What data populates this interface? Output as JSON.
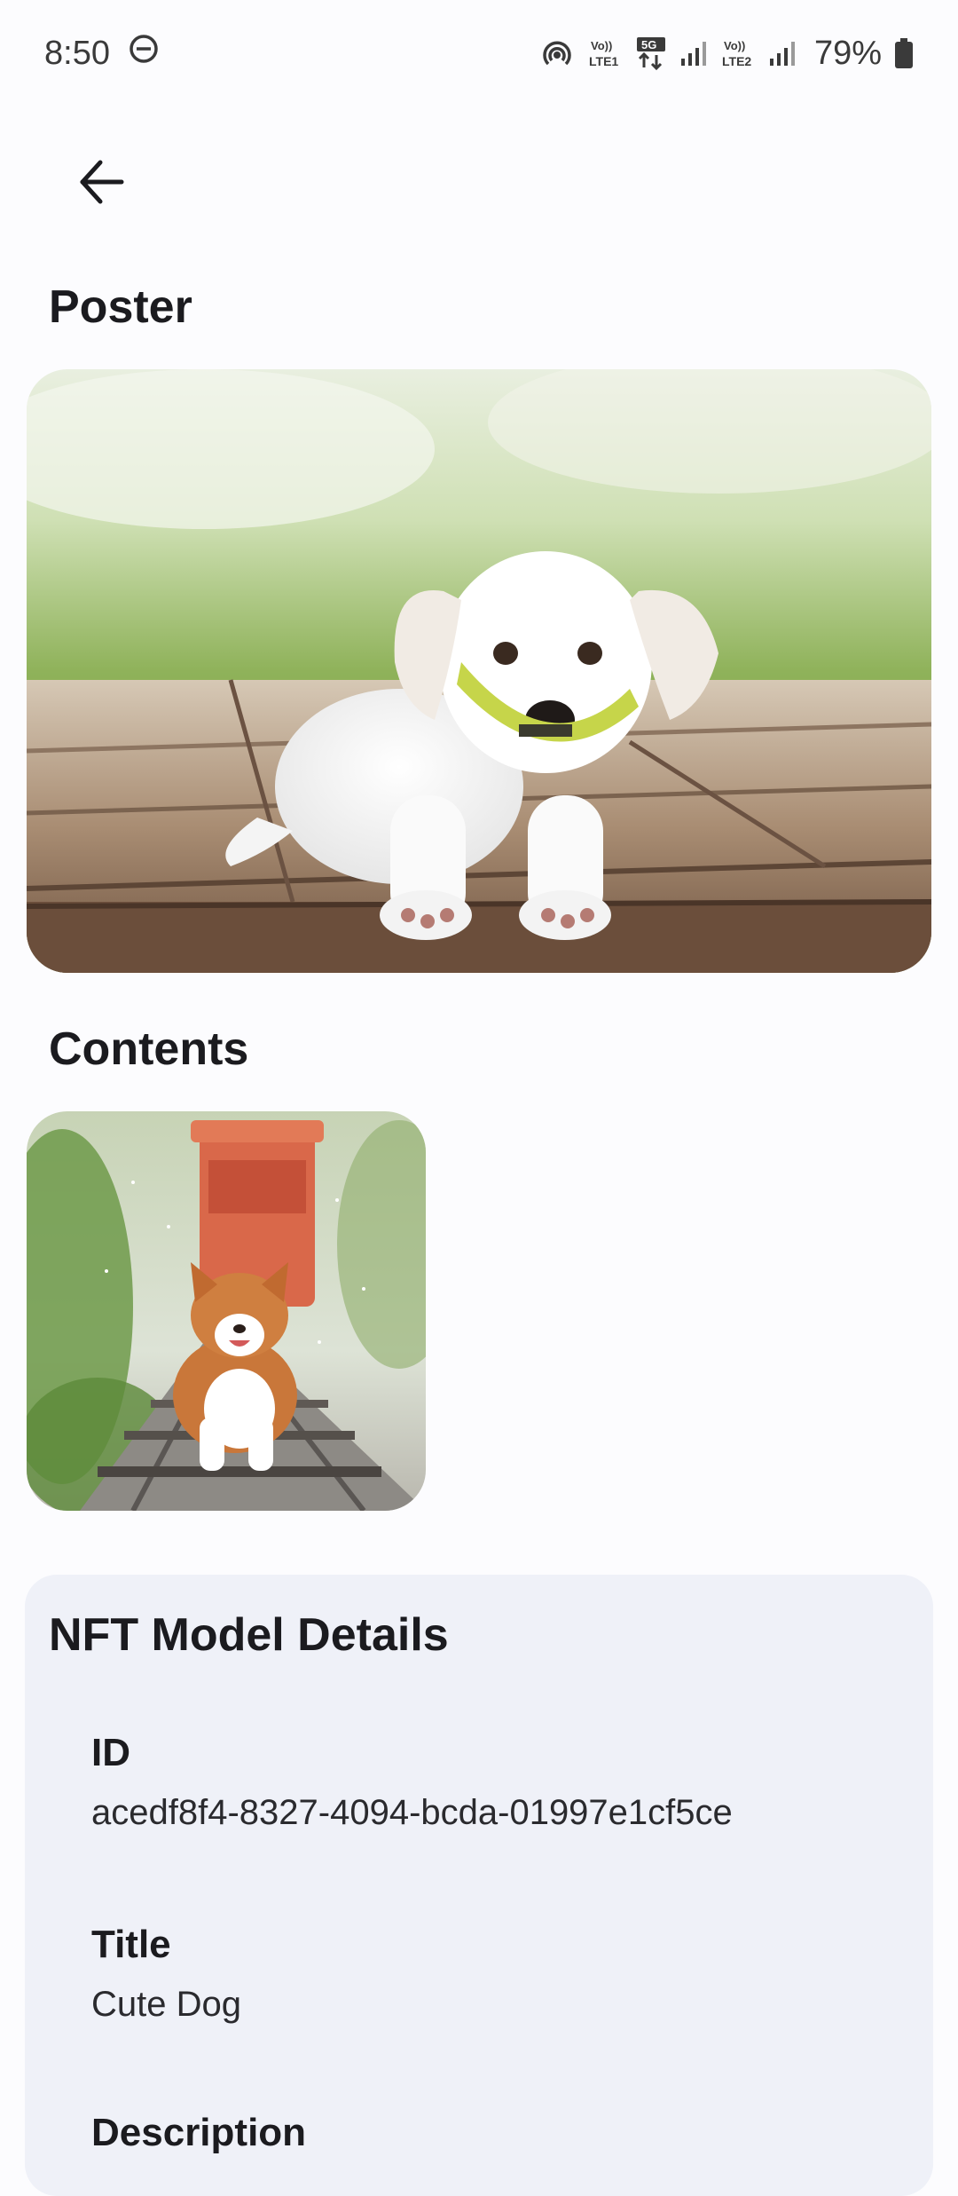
{
  "status_bar": {
    "time": "8:50",
    "battery_percent": "79%",
    "sim1_label": "LTE1",
    "sim2_label": "LTE2",
    "network_badge": "5G",
    "volte_label": "Vo))"
  },
  "icons": {
    "back": "arrow-left-icon",
    "dnd": "do-not-disturb-icon",
    "hotspot": "hotspot-icon",
    "signal": "signal-icon",
    "battery": "battery-icon"
  },
  "poster": {
    "title": "Poster"
  },
  "contents": {
    "title": "Contents"
  },
  "details": {
    "title": "NFT Model Details",
    "fields": [
      {
        "label": "ID",
        "value": "acedf8f4-8327-4094-bcda-01997e1cf5ce"
      },
      {
        "label": "Title",
        "value": "Cute Dog"
      },
      {
        "label": "Description",
        "value": ""
      }
    ]
  }
}
